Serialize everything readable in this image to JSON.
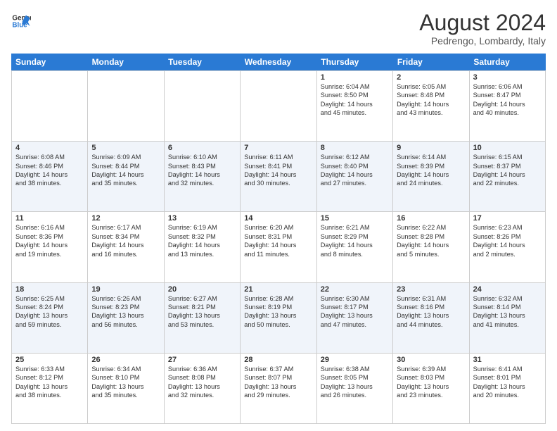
{
  "header": {
    "logo_line1": "General",
    "logo_line2": "Blue",
    "month_year": "August 2024",
    "location": "Pedrengo, Lombardy, Italy"
  },
  "days_of_week": [
    "Sunday",
    "Monday",
    "Tuesday",
    "Wednesday",
    "Thursday",
    "Friday",
    "Saturday"
  ],
  "weeks": [
    [
      {
        "day": "",
        "info": ""
      },
      {
        "day": "",
        "info": ""
      },
      {
        "day": "",
        "info": ""
      },
      {
        "day": "",
        "info": ""
      },
      {
        "day": "1",
        "info": "Sunrise: 6:04 AM\nSunset: 8:50 PM\nDaylight: 14 hours\nand 45 minutes."
      },
      {
        "day": "2",
        "info": "Sunrise: 6:05 AM\nSunset: 8:48 PM\nDaylight: 14 hours\nand 43 minutes."
      },
      {
        "day": "3",
        "info": "Sunrise: 6:06 AM\nSunset: 8:47 PM\nDaylight: 14 hours\nand 40 minutes."
      }
    ],
    [
      {
        "day": "4",
        "info": "Sunrise: 6:08 AM\nSunset: 8:46 PM\nDaylight: 14 hours\nand 38 minutes."
      },
      {
        "day": "5",
        "info": "Sunrise: 6:09 AM\nSunset: 8:44 PM\nDaylight: 14 hours\nand 35 minutes."
      },
      {
        "day": "6",
        "info": "Sunrise: 6:10 AM\nSunset: 8:43 PM\nDaylight: 14 hours\nand 32 minutes."
      },
      {
        "day": "7",
        "info": "Sunrise: 6:11 AM\nSunset: 8:41 PM\nDaylight: 14 hours\nand 30 minutes."
      },
      {
        "day": "8",
        "info": "Sunrise: 6:12 AM\nSunset: 8:40 PM\nDaylight: 14 hours\nand 27 minutes."
      },
      {
        "day": "9",
        "info": "Sunrise: 6:14 AM\nSunset: 8:39 PM\nDaylight: 14 hours\nand 24 minutes."
      },
      {
        "day": "10",
        "info": "Sunrise: 6:15 AM\nSunset: 8:37 PM\nDaylight: 14 hours\nand 22 minutes."
      }
    ],
    [
      {
        "day": "11",
        "info": "Sunrise: 6:16 AM\nSunset: 8:36 PM\nDaylight: 14 hours\nand 19 minutes."
      },
      {
        "day": "12",
        "info": "Sunrise: 6:17 AM\nSunset: 8:34 PM\nDaylight: 14 hours\nand 16 minutes."
      },
      {
        "day": "13",
        "info": "Sunrise: 6:19 AM\nSunset: 8:32 PM\nDaylight: 14 hours\nand 13 minutes."
      },
      {
        "day": "14",
        "info": "Sunrise: 6:20 AM\nSunset: 8:31 PM\nDaylight: 14 hours\nand 11 minutes."
      },
      {
        "day": "15",
        "info": "Sunrise: 6:21 AM\nSunset: 8:29 PM\nDaylight: 14 hours\nand 8 minutes."
      },
      {
        "day": "16",
        "info": "Sunrise: 6:22 AM\nSunset: 8:28 PM\nDaylight: 14 hours\nand 5 minutes."
      },
      {
        "day": "17",
        "info": "Sunrise: 6:23 AM\nSunset: 8:26 PM\nDaylight: 14 hours\nand 2 minutes."
      }
    ],
    [
      {
        "day": "18",
        "info": "Sunrise: 6:25 AM\nSunset: 8:24 PM\nDaylight: 13 hours\nand 59 minutes."
      },
      {
        "day": "19",
        "info": "Sunrise: 6:26 AM\nSunset: 8:23 PM\nDaylight: 13 hours\nand 56 minutes."
      },
      {
        "day": "20",
        "info": "Sunrise: 6:27 AM\nSunset: 8:21 PM\nDaylight: 13 hours\nand 53 minutes."
      },
      {
        "day": "21",
        "info": "Sunrise: 6:28 AM\nSunset: 8:19 PM\nDaylight: 13 hours\nand 50 minutes."
      },
      {
        "day": "22",
        "info": "Sunrise: 6:30 AM\nSunset: 8:17 PM\nDaylight: 13 hours\nand 47 minutes."
      },
      {
        "day": "23",
        "info": "Sunrise: 6:31 AM\nSunset: 8:16 PM\nDaylight: 13 hours\nand 44 minutes."
      },
      {
        "day": "24",
        "info": "Sunrise: 6:32 AM\nSunset: 8:14 PM\nDaylight: 13 hours\nand 41 minutes."
      }
    ],
    [
      {
        "day": "25",
        "info": "Sunrise: 6:33 AM\nSunset: 8:12 PM\nDaylight: 13 hours\nand 38 minutes."
      },
      {
        "day": "26",
        "info": "Sunrise: 6:34 AM\nSunset: 8:10 PM\nDaylight: 13 hours\nand 35 minutes."
      },
      {
        "day": "27",
        "info": "Sunrise: 6:36 AM\nSunset: 8:08 PM\nDaylight: 13 hours\nand 32 minutes."
      },
      {
        "day": "28",
        "info": "Sunrise: 6:37 AM\nSunset: 8:07 PM\nDaylight: 13 hours\nand 29 minutes."
      },
      {
        "day": "29",
        "info": "Sunrise: 6:38 AM\nSunset: 8:05 PM\nDaylight: 13 hours\nand 26 minutes."
      },
      {
        "day": "30",
        "info": "Sunrise: 6:39 AM\nSunset: 8:03 PM\nDaylight: 13 hours\nand 23 minutes."
      },
      {
        "day": "31",
        "info": "Sunrise: 6:41 AM\nSunset: 8:01 PM\nDaylight: 13 hours\nand 20 minutes."
      }
    ]
  ]
}
